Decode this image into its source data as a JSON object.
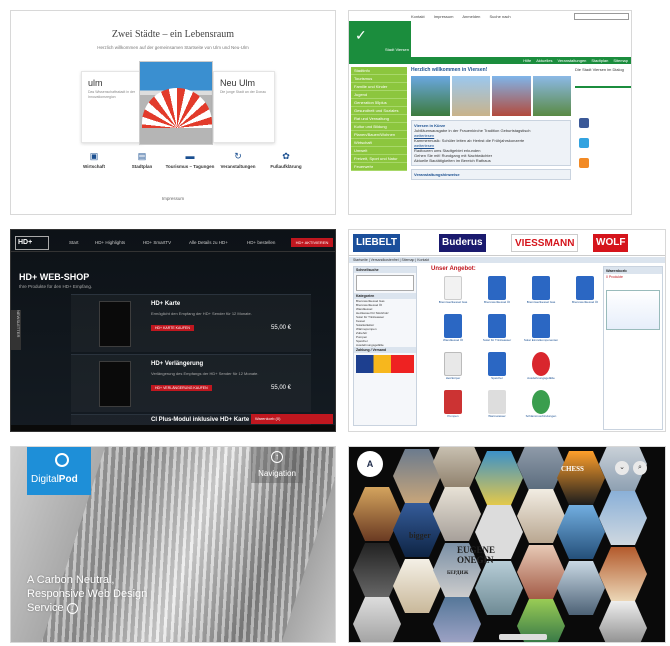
{
  "tile1": {
    "title": "Zwei Städte – ein Lebensraum",
    "subtitle": "Herzlich willkommen auf der gemeinsamen Startseite von Ulm und Neu-Ulm",
    "left_city": "ulm",
    "left_text": "Das Wissenschaftsstadt in der Innovationsregion",
    "right_city": "Neu Ulm",
    "right_text": "Die junge Stadt an der Donau",
    "nav": [
      {
        "label": "Wirtschaft",
        "icon": "briefcase-icon"
      },
      {
        "label": "Stadtplan",
        "icon": "map-icon"
      },
      {
        "label": "Tourismus – Tagungen",
        "icon": "bed-icon"
      },
      {
        "label": "Veranstaltungen",
        "icon": "calendar-icon"
      },
      {
        "label": "Fußaufklärung",
        "icon": "leaf-icon"
      }
    ],
    "footer": "Impressum"
  },
  "tile2": {
    "top_links": [
      "Kontakt",
      "Impressum",
      "Anmelden",
      "Suche nach"
    ],
    "logo": "Stadt Viersen",
    "menu": [
      "Hilfe",
      "Aktuelles",
      "Veranstaltungen",
      "Stadtplan",
      "Sitemap"
    ],
    "side": [
      "Stadtinfo",
      "Tourismus",
      "Familie und Kinder",
      "Jugend",
      "Generation 55plus",
      "Gesundheit und Soziales",
      "Rat und Verwaltung",
      "Kultur und Bildung",
      "Planen/Bauen/Wohnen",
      "Wirtschaft",
      "Umwelt",
      "Freizeit, Sport und Natur",
      "Feuerwehr"
    ],
    "welcome": "Herzlich willkommen in Viersen!",
    "right_title": "Die Stadt Viersen im Dialog",
    "news_title": "Viersen in Kürze",
    "news": [
      "Jubiläumsausgabe in der Frauenkirche Tradition Geburtstagstisch",
      "Kammermusik: Schüler leiten ab Herbst die Frühjahrskonzerte",
      "Radtouren ums Stadtgebiet erkunden",
      "Gehen Sie mit! Rundgang mit Nachtwächter",
      "Aktuelle Bautätigkeiten im Bereich Rathaus"
    ],
    "link": "weiterlesen",
    "footer_title": "Veranstaltungshinweise"
  },
  "tile3": {
    "logo": "HD+",
    "nav": [
      "Start",
      "HD+ Highlights",
      "HD+ SmartTV",
      "Alle Details zu HD+",
      "HD+ bestellen"
    ],
    "activate": "HD+ AKTIVIEREN",
    "title": "HD+ WEB-SHOP",
    "subtitle": "Ihre Produkte für den HD+ Empfang.",
    "products": [
      {
        "name": "HD+ Karte",
        "desc": "Ermöglicht den Empfang der HD+ Sender für 12 Monate.",
        "button": "HD+ KARTE KAUFEN",
        "price": "55,00 €"
      },
      {
        "name": "HD+ Verlängerung",
        "desc": "Verlängerung des Empfangs der HD+ Sender für 12 Monate.",
        "button": "HD+ VERLÄNGERUNG KAUFEN",
        "price": "55,00 €"
      }
    ],
    "next": "CI Plus-Modul inklusive HD+ Karte",
    "side_tab": "NEWSLETTER",
    "cart": "Warenkorb (0)"
  },
  "tile4": {
    "brands": [
      "LIEBELT",
      "Buderus",
      "VIESSMANN",
      "WOLF"
    ],
    "menu": "Startseite  |  Versandkostenfrei  |  Sitemap  |  Kontakt",
    "search_title": "Schnellsuche",
    "categories_title": "Kategorien",
    "categories": [
      "Brennwertkessel Gas",
      "Brennwertkessel Öl",
      "Wandkessel",
      "Heizkessel für Stückholz",
      "Solar für Trinkwasser",
      "Kessel",
      "Solarkollektor",
      "Wärmepumpen",
      "Zubehör",
      "Pumpen",
      "Speicher",
      "Ausdehnungsgefäße"
    ],
    "payment_title": "Zahlung / Versand",
    "offers_title": "Unser Angebot:",
    "products": [
      "Brennwertkessel Gas",
      "Brennwertkessel Öl",
      "Brennwertkessel Gas",
      "Brennwertkessel Öl",
      "Wandkessel Öl",
      "Solar für Trinkwasser",
      "Solar Einzelkomponenten",
      "Heizkörper",
      "Speicher",
      "Ausdehnungsgefäße",
      "Pumpen",
      "Warmwasser",
      "Schlammverbindungen"
    ],
    "right_title": "Warenkorb",
    "right_sub": "0 Produkte"
  },
  "tile5": {
    "brand_a": "Digital",
    "brand_b": "Pod",
    "nav": "Navigation",
    "tagline": [
      "A Carbon Neutral,",
      "Responsive Web Design",
      "Service"
    ]
  },
  "tile6": {
    "tiles": [
      "bigger",
      "EUGENE ONEGIN",
      "CHESS",
      "БЕРДИЖ"
    ]
  }
}
